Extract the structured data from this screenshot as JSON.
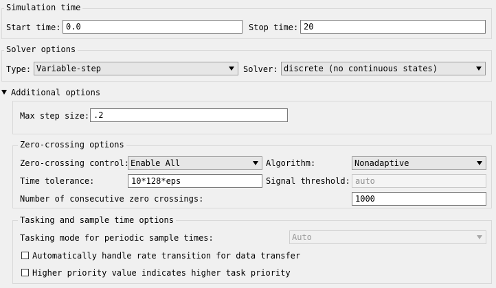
{
  "simulation_time": {
    "title": "Simulation time",
    "start_label": "Start time:",
    "start_value": "0.0",
    "stop_label": "Stop time:",
    "stop_value": "20"
  },
  "solver_options": {
    "title": "Solver options",
    "type_label": "Type:",
    "type_value": "Variable-step",
    "solver_label": "Solver:",
    "solver_value": "discrete (no continuous states)"
  },
  "additional_options": {
    "title": "Additional options",
    "max_step_label": "Max step size:",
    "max_step_value": ".2"
  },
  "zero_crossing": {
    "title": "Zero-crossing options",
    "control_label": "Zero-crossing control:",
    "control_value": "Enable All",
    "algorithm_label": "Algorithm:",
    "algorithm_value": "Nonadaptive",
    "tolerance_label": "Time tolerance:",
    "tolerance_value": "10*128*eps",
    "threshold_label": "Signal threshold:",
    "threshold_value": "auto",
    "consecutive_label": "Number of consecutive zero crossings:",
    "consecutive_value": "1000"
  },
  "tasking": {
    "title": "Tasking and sample time options",
    "mode_label": "Tasking mode for periodic sample times:",
    "mode_value": "Auto",
    "rate_transition_label": "Automatically handle rate transition for data transfer",
    "rate_transition_checked": false,
    "priority_label": "Higher priority value indicates higher task priority",
    "priority_checked": false
  }
}
